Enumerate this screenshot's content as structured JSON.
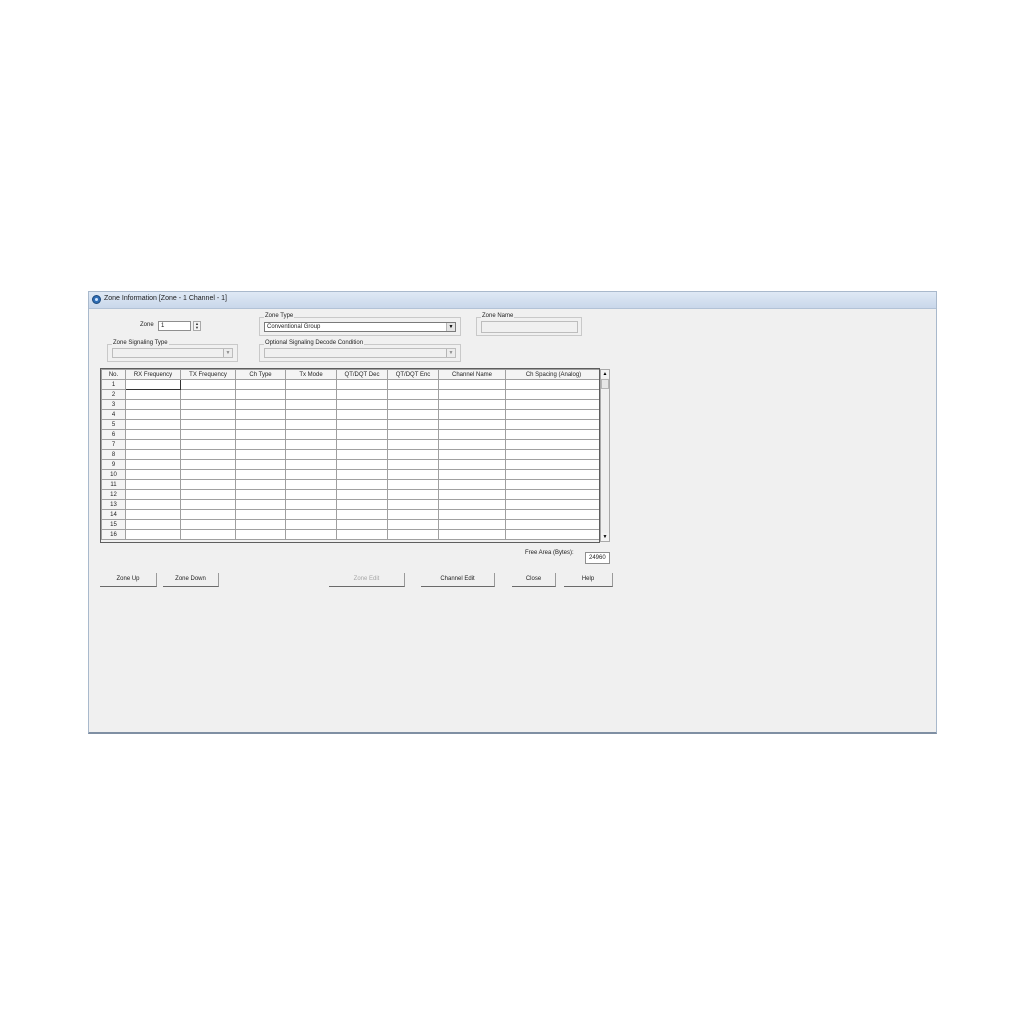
{
  "window": {
    "title": "Zone Information [Zone - 1  Channel  -  1]"
  },
  "zone": {
    "label": "Zone",
    "value": "1"
  },
  "zone_type": {
    "legend": "Zone Type",
    "value": "Conventional Group"
  },
  "zone_name": {
    "legend": "Zone Name",
    "value": ""
  },
  "zone_signaling_type": {
    "legend": "Zone Signaling Type",
    "value": ""
  },
  "optional_signaling": {
    "legend": "Optional Signaling Decode Condition",
    "value": ""
  },
  "table": {
    "headers": [
      "No.",
      "RX Frequency",
      "TX Frequency",
      "Ch Type",
      "Tx Mode",
      "QT/DQT Dec",
      "QT/DQT Enc",
      "Channel Name",
      "Ch Spacing (Analog)"
    ],
    "rows": [
      "1",
      "2",
      "3",
      "4",
      "5",
      "6",
      "7",
      "8",
      "9",
      "10",
      "11",
      "12",
      "13",
      "14",
      "15",
      "16"
    ]
  },
  "free_area": {
    "label": "Free Area (Bytes):",
    "value": "24960"
  },
  "buttons": {
    "zone_up": "Zone Up",
    "zone_down": "Zone Down",
    "zone_edit": "Zone Edit",
    "channel_edit": "Channel Edit",
    "close": "Close",
    "help": "Help"
  },
  "icons": {
    "app": "app-logo-icon",
    "spin_up": "spin-up-icon",
    "spin_down": "spin-down-icon",
    "dropdown": "chevron-down-icon",
    "scroll_up": "scroll-up-icon",
    "scroll_down": "scroll-down-icon"
  },
  "colors": {
    "titlebar": "#c9d7ea",
    "window_bg": "#f0f0f0",
    "border": "#a9b9cc"
  }
}
